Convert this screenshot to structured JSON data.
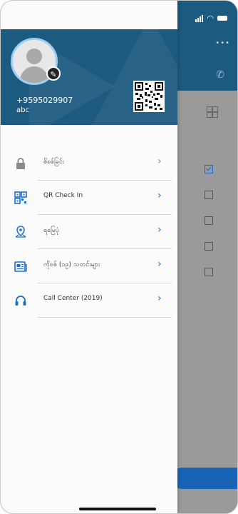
{
  "background": {
    "checkboxes": [
      {
        "checked": true
      },
      {
        "checked": false
      },
      {
        "checked": false
      },
      {
        "checked": false
      },
      {
        "checked": false
      }
    ]
  },
  "drawer": {
    "profile": {
      "phone": "+9595029907",
      "username": "abc"
    },
    "menu": [
      {
        "label": "စိစစ်ခြင်း",
        "icon": "lock-icon",
        "chevron_color": "grey"
      },
      {
        "label": "QR Check In",
        "icon": "qr-grid-icon",
        "chevron_color": "blue"
      },
      {
        "label": "ရမြေပုံ",
        "icon": "map-pin-icon",
        "chevron_color": "blue"
      },
      {
        "label": "ကိုဗစ် (၁၉) သတင်းများ",
        "icon": "news-icon",
        "chevron_color": "blue"
      },
      {
        "label": "Call Center (2019)",
        "icon": "headset-icon",
        "chevron_color": "blue"
      }
    ]
  },
  "colors": {
    "header_blue": "#1d5a80",
    "accent_blue": "#1b6fd1"
  }
}
